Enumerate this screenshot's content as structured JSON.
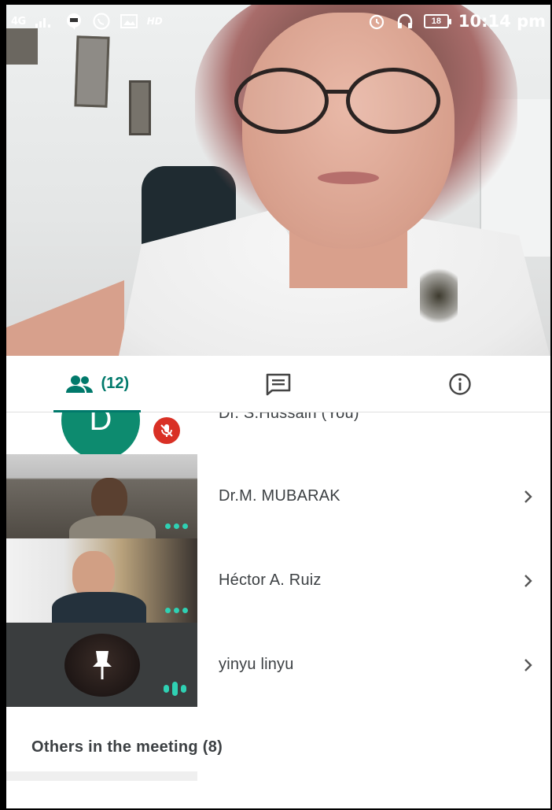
{
  "status_bar": {
    "network": "4G",
    "hd_label": "HD",
    "battery_level": "18",
    "time": "10:14 pm"
  },
  "tabs": [
    {
      "name": "people",
      "label": "(12)",
      "icon": "people-icon",
      "active": true
    },
    {
      "name": "chat",
      "label": "",
      "icon": "chat-icon",
      "active": false
    },
    {
      "name": "info",
      "label": "",
      "icon": "info-icon",
      "active": false
    }
  ],
  "participants": [
    {
      "name": "Dr. S.Hussain (You)",
      "avatar_initial": "D",
      "muted": true
    },
    {
      "name": "Dr.M. MUBARAK",
      "status": "video"
    },
    {
      "name": "Héctor A. Ruiz",
      "status": "video"
    },
    {
      "name": "yinyu linyu",
      "status": "speaking"
    }
  ],
  "others": {
    "label": "Others in the meeting (8)"
  },
  "colors": {
    "accent": "#00796b",
    "avatar_bg": "#0d8b6f",
    "mute_red": "#d93025",
    "activity_teal": "#2fd1b3"
  }
}
